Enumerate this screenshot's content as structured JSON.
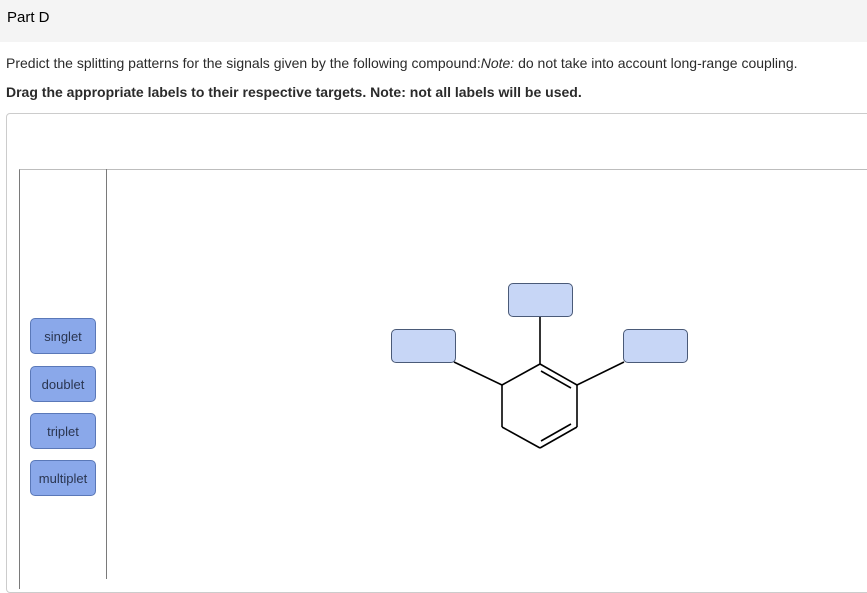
{
  "header": {
    "part_title": "Part D"
  },
  "question": {
    "text_before": "Predict the splitting patterns for the signals given by the following compound:",
    "note_label": "Note:",
    "text_after": " do not take into account long-range coupling."
  },
  "instruction": "Drag the appropriate labels to their respective targets. Note: not all labels will be used.",
  "labels": [
    "singlet",
    "doublet",
    "triplet",
    "multiplet"
  ],
  "colors": {
    "label_fill": "#8aa8ea",
    "target_fill": "#c7d6f6",
    "header_bg": "#f4f4f4"
  }
}
